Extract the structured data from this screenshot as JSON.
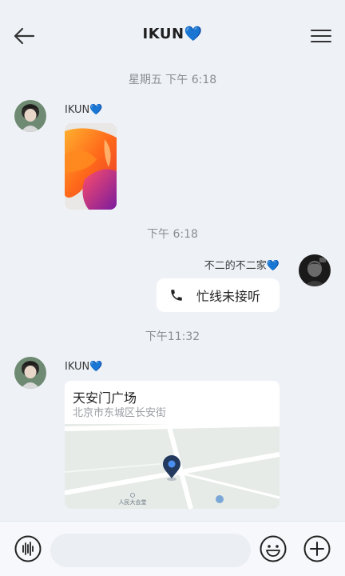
{
  "header": {
    "title": "IKUN",
    "title_emoji": "💙",
    "back_icon": "arrow-left-icon",
    "menu_icon": "hamburger-menu-icon"
  },
  "messages": [
    {
      "type": "timestamp",
      "text": "星期五 下午 6:18"
    },
    {
      "type": "image",
      "sender": "IKUN",
      "sender_emoji": "💙",
      "side": "left"
    },
    {
      "type": "timestamp",
      "text": "下午 6:18"
    },
    {
      "type": "call",
      "sender": "不二的不二家",
      "sender_emoji": "💙",
      "side": "right",
      "text": "忙线未接听",
      "icon": "phone-icon"
    },
    {
      "type": "timestamp",
      "text": "下午11:32"
    },
    {
      "type": "location",
      "sender": "IKUN",
      "sender_emoji": "💙",
      "side": "left",
      "title": "天安门广场",
      "address": "北京市东城区长安街",
      "map_label": "人民大会堂"
    }
  ],
  "input_bar": {
    "placeholder": "",
    "voice_icon": "voice-wave-icon",
    "emoji_icon": "smiley-icon",
    "plus_icon": "plus-circle-icon"
  },
  "colors": {
    "background": "#eef2f7",
    "bubble": "#ffffff",
    "accent_heart": "#2e7df2",
    "timestamp": "#8a8d93",
    "map_pin": "#233a5e"
  }
}
